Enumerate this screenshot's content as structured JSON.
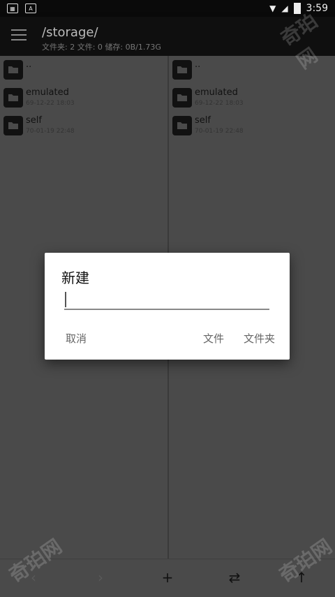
{
  "status_bar": {
    "left_icons": [
      "notification-icon",
      "app-a-icon"
    ],
    "app_badge": "A",
    "time": "3:59"
  },
  "toolbar": {
    "path": "/storage/",
    "summary": "文件夹: 2  文件: 0  储存: 0B/1.73G"
  },
  "left_pane": {
    "items": [
      {
        "name": "..",
        "date": ""
      },
      {
        "name": "emulated",
        "date": "69-12-22 18:03"
      },
      {
        "name": "self",
        "date": "70-01-19 22:48"
      }
    ]
  },
  "right_pane": {
    "items": [
      {
        "name": "..",
        "date": ""
      },
      {
        "name": "emulated",
        "date": "69-12-22 18:03"
      },
      {
        "name": "self",
        "date": "70-01-19 22:48"
      }
    ]
  },
  "dialog": {
    "title": "新建",
    "input_value": "",
    "cancel_label": "取消",
    "file_label": "文件",
    "folder_label": "文件夹"
  },
  "bottom_bar": {
    "back": "‹",
    "forward": "›",
    "add": "+",
    "swap": "⇄",
    "up": "↑"
  },
  "watermark": "奇珀网"
}
